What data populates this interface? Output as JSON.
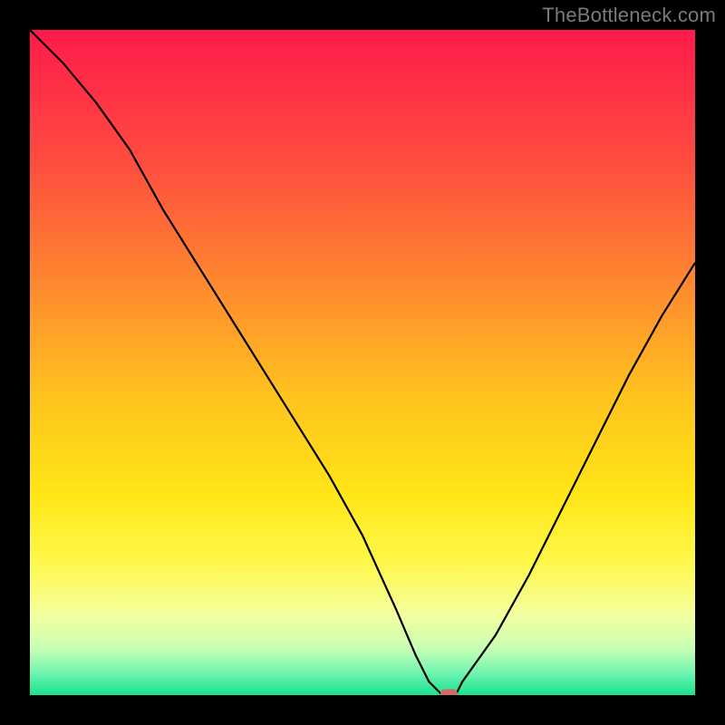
{
  "watermark": "TheBottleneck.com",
  "chart_data": {
    "type": "line",
    "title": "",
    "xlabel": "",
    "ylabel": "",
    "xlim": [
      0,
      100
    ],
    "ylim": [
      0,
      100
    ],
    "background": {
      "type": "vertical_gradient",
      "stops": [
        {
          "pos": 0.0,
          "color": "#ff1a4b"
        },
        {
          "pos": 0.2,
          "color": "#ff4d3f"
        },
        {
          "pos": 0.4,
          "color": "#ff8f2e"
        },
        {
          "pos": 0.55,
          "color": "#ffc21e"
        },
        {
          "pos": 0.7,
          "color": "#ffe617"
        },
        {
          "pos": 0.8,
          "color": "#fff84a"
        },
        {
          "pos": 0.88,
          "color": "#f4ffa0"
        },
        {
          "pos": 0.93,
          "color": "#c8ffb4"
        },
        {
          "pos": 0.965,
          "color": "#74f5b2"
        },
        {
          "pos": 1.0,
          "color": "#18e28f"
        }
      ]
    },
    "series": [
      {
        "name": "bottleneck-curve",
        "color": "#000000",
        "stroke_width": 2.2,
        "x": [
          0,
          5,
          10,
          15,
          20,
          25,
          30,
          35,
          40,
          45,
          50,
          55,
          58,
          60,
          62,
          64,
          65,
          70,
          75,
          80,
          85,
          90,
          95,
          100
        ],
        "y": [
          100,
          95,
          89,
          82,
          73,
          65,
          57,
          49,
          41,
          33,
          24,
          13,
          6,
          2,
          0,
          0,
          2,
          9,
          18,
          28,
          38,
          48,
          57,
          65
        ]
      }
    ],
    "markers": [
      {
        "name": "target-marker",
        "x": 63,
        "y": 0,
        "shape": "rounded-rect",
        "w_pct": 2.6,
        "h_pct": 1.8,
        "color": "#d26b63"
      }
    ]
  }
}
